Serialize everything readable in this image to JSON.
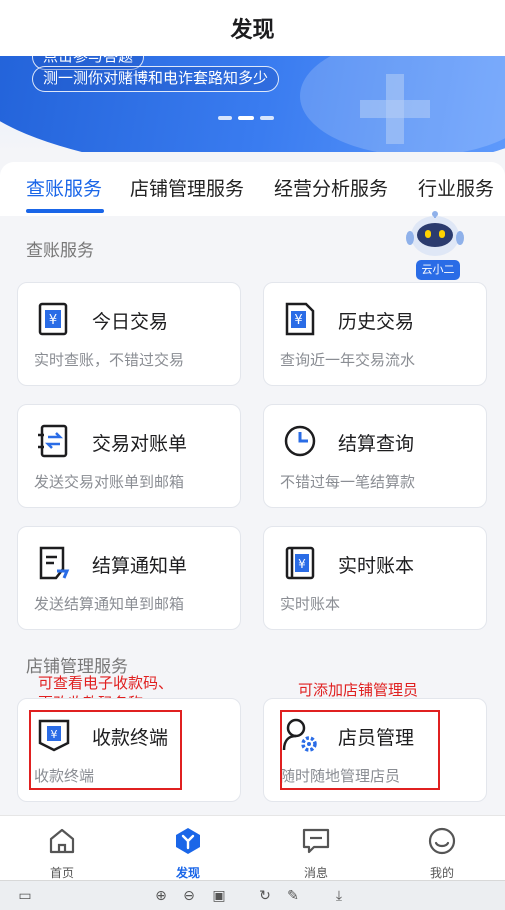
{
  "header": {
    "title": "发现"
  },
  "banner": {
    "top_pill_text": "点击参与答题",
    "main_pill_text": "测一测你对赌博和电诈套路知多少"
  },
  "tabs": [
    {
      "label": "查账服务"
    },
    {
      "label": "店铺管理服务"
    },
    {
      "label": "经营分析服务"
    },
    {
      "label": "行业服务"
    }
  ],
  "sections": {
    "checking": {
      "title": "查账服务"
    },
    "store": {
      "title": "店铺管理服务"
    }
  },
  "assistant": {
    "label": "云小二"
  },
  "cards": {
    "today_trade": {
      "name": "今日交易",
      "desc": "实时查账，不错过交易"
    },
    "history_trade": {
      "name": "历史交易",
      "desc": "查询近一年交易流水"
    },
    "reconcile": {
      "name": "交易对账单",
      "desc": "发送交易对账单到邮箱"
    },
    "settlement_query": {
      "name": "结算查询",
      "desc": "不错过每一笔结算款"
    },
    "settlement_notice": {
      "name": "结算通知单",
      "desc": "发送结算通知单到邮箱"
    },
    "realtime_ledger": {
      "name": "实时账本",
      "desc": "实时账本"
    },
    "payment_terminal": {
      "name": "收款终端",
      "desc": "收款终端"
    },
    "staff_manage": {
      "name": "店员管理",
      "desc": "随时随地管理店员"
    }
  },
  "annotations": {
    "terminal_line1": "可查看电子收款码、",
    "terminal_line2": "更改收款码名称",
    "staff": "可添加店铺管理员"
  },
  "bottom_nav": [
    {
      "label": "首页",
      "icon": "home-icon"
    },
    {
      "label": "发现",
      "icon": "discover-icon"
    },
    {
      "label": "消息",
      "icon": "message-icon"
    },
    {
      "label": "我的",
      "icon": "profile-icon"
    }
  ],
  "colors": {
    "accent": "#1a66e8",
    "annotation_red": "#e02020",
    "background": "#f4f5f8"
  }
}
